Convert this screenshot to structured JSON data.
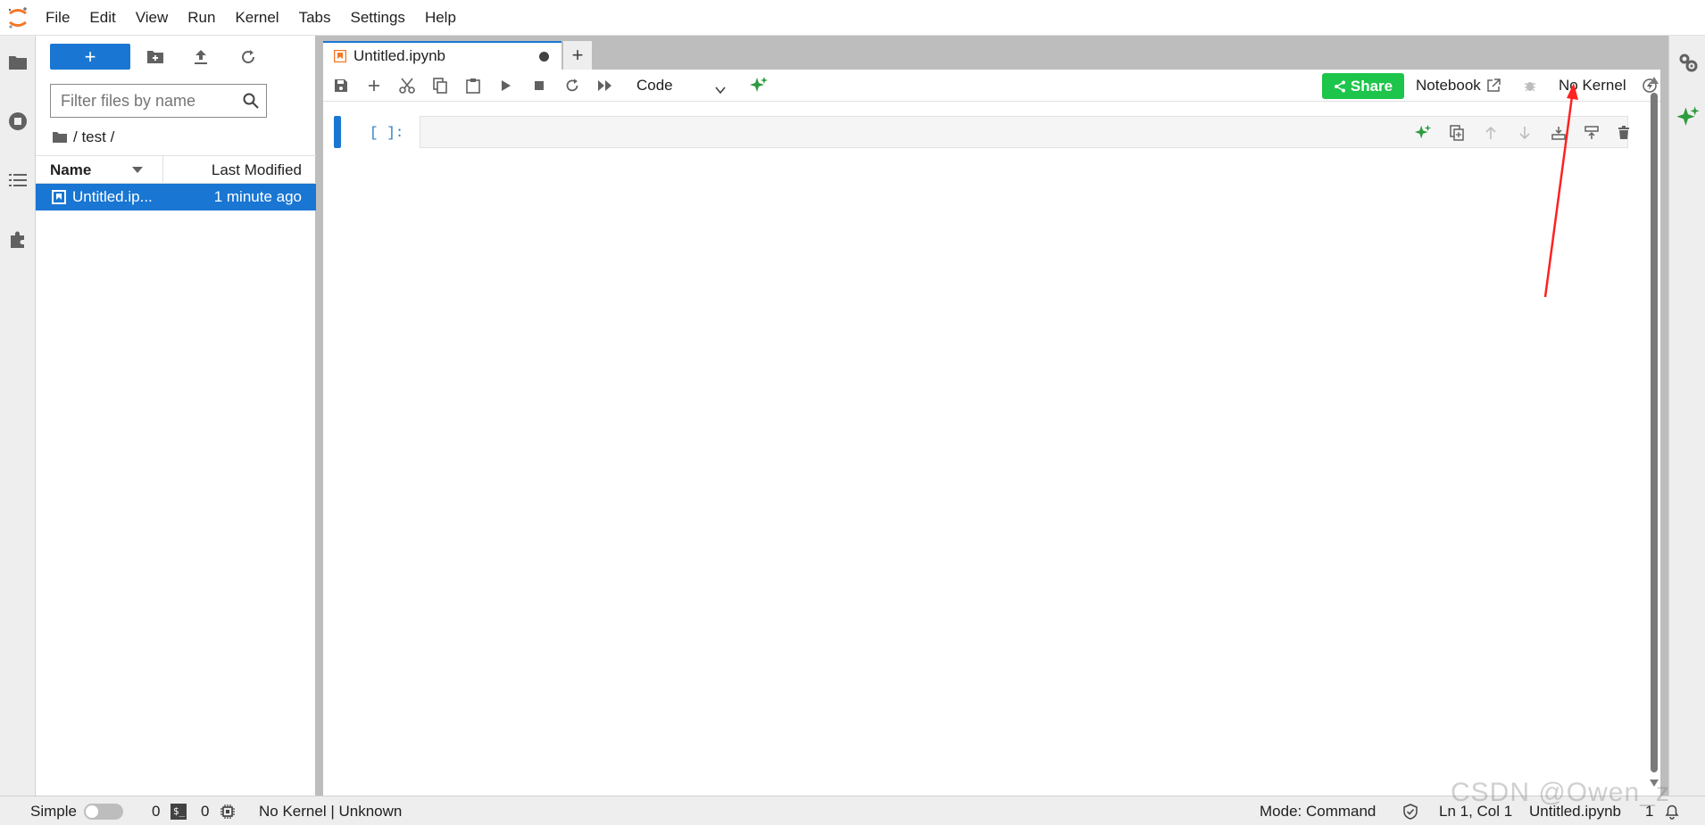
{
  "menubar": {
    "items": [
      "File",
      "Edit",
      "View",
      "Run",
      "Kernel",
      "Tabs",
      "Settings",
      "Help"
    ]
  },
  "filebrowser": {
    "new_label": "+",
    "filter_placeholder": "Filter files by name",
    "breadcrumb": "/ test /",
    "columns": {
      "name": "Name",
      "modified": "Last Modified"
    },
    "files": [
      {
        "name": "Untitled.ip...",
        "modified": "1 minute ago",
        "selected": true
      }
    ]
  },
  "tabs": {
    "active": {
      "title": "Untitled.ipynb",
      "dirty": true
    },
    "add_label": "+"
  },
  "notebook": {
    "cell_type": "Code",
    "share_label": "Share",
    "notebook_label": "Notebook",
    "kernel_label": "No Kernel",
    "cells": [
      {
        "prompt": "[ ]:",
        "source": ""
      }
    ]
  },
  "statusbar": {
    "mode_label": "Simple",
    "terminals_count": "0",
    "kernels_count": "0",
    "kernel_status": "No Kernel | Unknown",
    "command_mode": "Mode: Command",
    "cursor": "Ln 1, Col 1",
    "filename": "Untitled.ipynb",
    "notifications": "1"
  },
  "watermark": "CSDN @Owen_z",
  "colors": {
    "accent": "#1976d2",
    "share": "#1dc54a",
    "ai_green": "#2e9c3e",
    "annotation": "#ff2020"
  }
}
